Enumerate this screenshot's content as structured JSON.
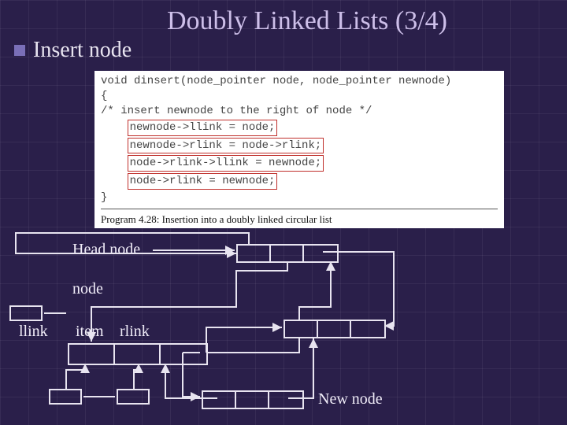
{
  "title": "Doubly Linked Lists (3/4)",
  "subtitle": "Insert node",
  "code": {
    "signature": "void dinsert(node_pointer node, node_pointer newnode)",
    "open_brace": "{",
    "comment": "/* insert newnode to the right of node */",
    "lines": [
      "newnode->llink = node;",
      "newnode->rlink = node->rlink;",
      "node->rlink->llink = newnode;",
      "node->rlink = newnode;"
    ],
    "close_brace": "}",
    "caption": "Program 4.28: Insertion into a doubly linked circular list"
  },
  "diagram": {
    "labels": {
      "head_node": "Head node",
      "node": "node",
      "llink": "llink",
      "item": "item",
      "rlink": "rlink",
      "new_node": "New node"
    }
  }
}
